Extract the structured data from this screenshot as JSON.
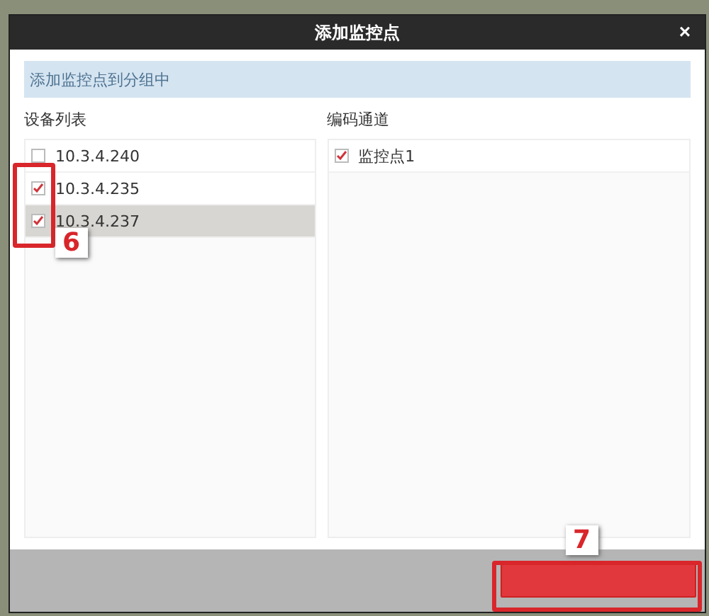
{
  "window": {
    "title": "添加监控点",
    "close": "×"
  },
  "banner": "添加监控点到分组中",
  "device_list": {
    "label": "设备列表",
    "items": [
      {
        "name": "10.3.4.240",
        "checked": false,
        "selected": false
      },
      {
        "name": "10.3.4.235",
        "checked": true,
        "selected": false
      },
      {
        "name": "10.3.4.237",
        "checked": true,
        "selected": true
      }
    ]
  },
  "channels": {
    "label": "编码通道",
    "items": [
      {
        "name": "监控点1",
        "checked": true
      }
    ]
  },
  "annotations": [
    {
      "number": "6"
    },
    {
      "number": "7"
    }
  ]
}
